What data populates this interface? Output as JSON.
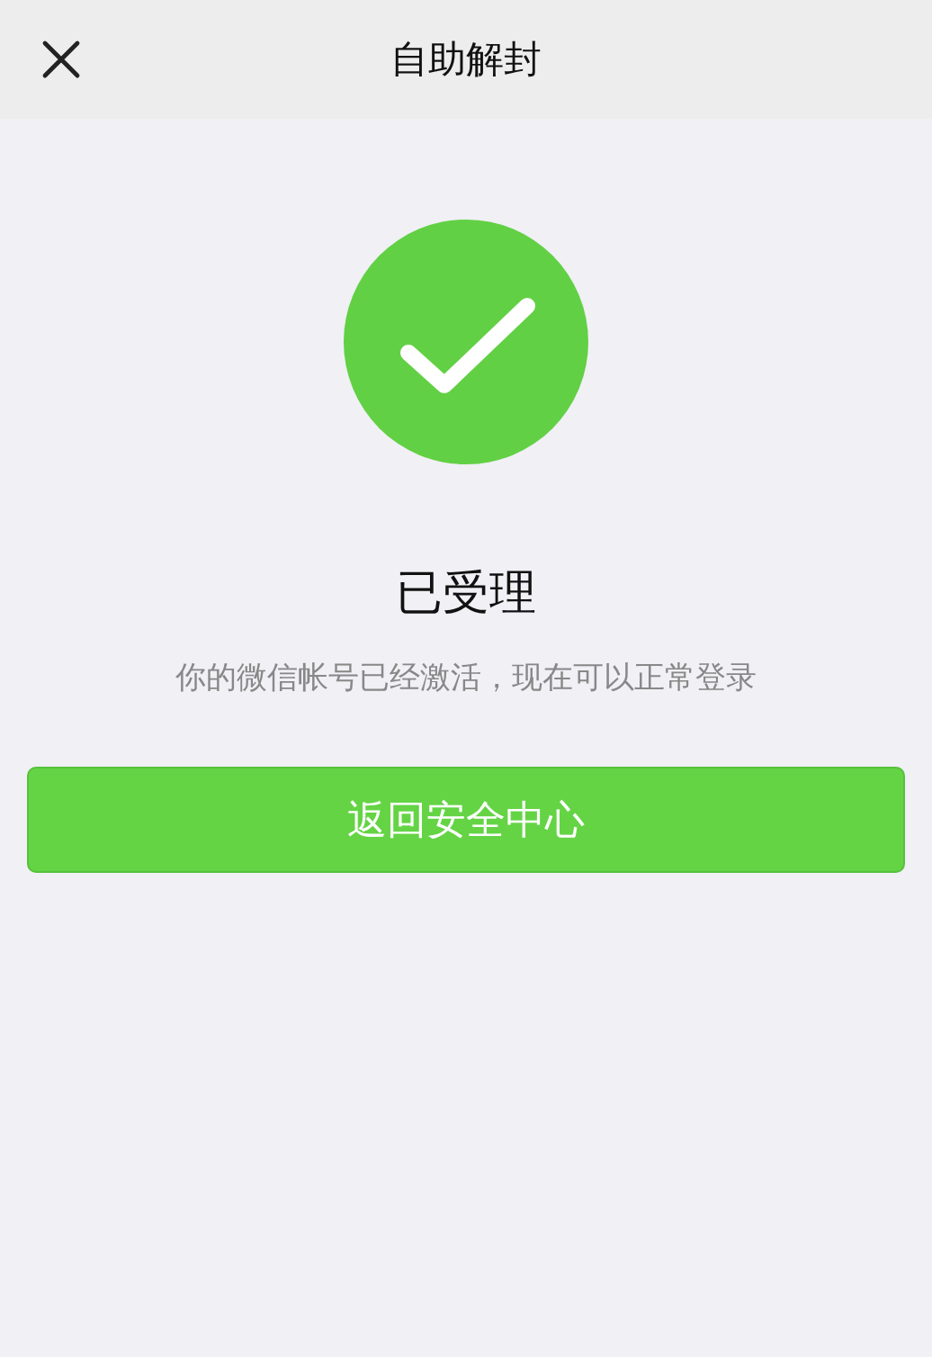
{
  "header": {
    "title": "自助解封"
  },
  "result": {
    "success": true,
    "title": "已受理",
    "message": "你的微信帐号已经激活，现在可以正常登录"
  },
  "button": {
    "label": "返回安全中心"
  }
}
